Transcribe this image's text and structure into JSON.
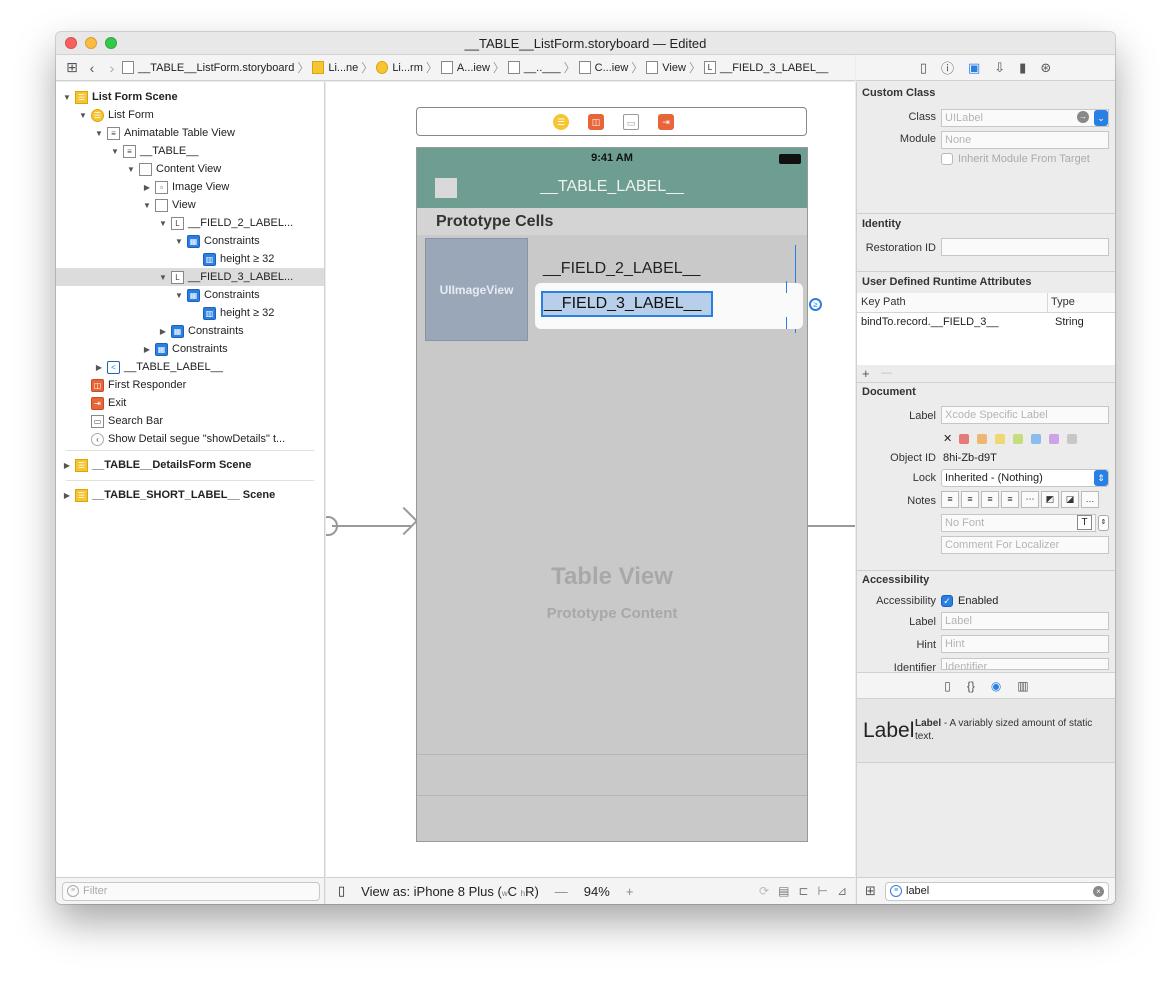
{
  "window": {
    "title": "__TABLE__ListForm.storyboard — Edited",
    "colors": {
      "close": "#fc605c",
      "minimize": "#fdbc40",
      "zoom": "#34c84a",
      "accent": "#2a7fe3"
    }
  },
  "jumpbar": {
    "crumbs": [
      {
        "label": "__TABLE__ListForm.storyboard",
        "icon": "storyboard-file-icon"
      },
      {
        "label": "Li...ne",
        "icon": "scene-icon"
      },
      {
        "label": "Li...rm",
        "icon": "view-controller-icon"
      },
      {
        "label": "A...iew",
        "icon": "table-view-icon"
      },
      {
        "label": "__..___",
        "icon": "table-cell-icon"
      },
      {
        "label": "C...iew",
        "icon": "view-icon"
      },
      {
        "label": "View",
        "icon": "view-icon"
      },
      {
        "label": "__FIELD_3_LABEL__",
        "icon": "label-icon",
        "glyph": "L"
      }
    ]
  },
  "navigator": {
    "rows": [
      {
        "label": "List Form Scene",
        "bold": true,
        "disclosure": "▼",
        "icon": "scene-icon",
        "glyph": "☰"
      },
      {
        "label": "List Form",
        "disclosure": "▼",
        "icon": "view-controller-icon",
        "glyph": "☰"
      },
      {
        "label": "Animatable Table View",
        "disclosure": "▼",
        "icon": "table-view-icon",
        "glyph": "≡"
      },
      {
        "label": "__TABLE__",
        "disclosure": "▼",
        "icon": "table-cell-icon",
        "glyph": "≡"
      },
      {
        "label": "Content View",
        "disclosure": "▼",
        "icon": "view-icon",
        "glyph": ""
      },
      {
        "label": "Image View",
        "disclosure": "▶",
        "icon": "image-view-icon",
        "glyph": "▫"
      },
      {
        "label": "View",
        "disclosure": "▼",
        "icon": "view-icon",
        "glyph": ""
      },
      {
        "label": "__FIELD_2_LABEL...",
        "disclosure": "▼",
        "icon": "label-icon",
        "glyph": "L"
      },
      {
        "label": "Constraints",
        "disclosure": "▼",
        "icon": "constraints-icon",
        "glyph": "▦"
      },
      {
        "label": "height ≥ 32",
        "disclosure": "",
        "icon": "constraint-icon",
        "glyph": "▥"
      },
      {
        "label": "__FIELD_3_LABEL...",
        "disclosure": "▼",
        "icon": "label-icon",
        "glyph": "L",
        "selected": true
      },
      {
        "label": "Constraints",
        "disclosure": "▼",
        "icon": "constraints-icon",
        "glyph": "▦"
      },
      {
        "label": "height ≥ 32",
        "disclosure": "",
        "icon": "constraint-icon",
        "glyph": "▥"
      },
      {
        "label": "Constraints",
        "disclosure": "▶",
        "icon": "constraints-icon",
        "glyph": "▦"
      },
      {
        "label": "Constraints",
        "disclosure": "▶",
        "icon": "constraints-icon",
        "glyph": "▦"
      },
      {
        "label": "__TABLE_LABEL__",
        "disclosure": "▶",
        "icon": "navigation-item-icon",
        "glyph": "<"
      },
      {
        "label": "First Responder",
        "disclosure": "",
        "icon": "first-responder-icon",
        "glyph": "◫"
      },
      {
        "label": "Exit",
        "disclosure": "",
        "icon": "exit-icon",
        "glyph": "⇥"
      },
      {
        "label": "Search Bar",
        "disclosure": "",
        "icon": "search-bar-icon",
        "glyph": "▭"
      },
      {
        "label": "Show Detail segue \"showDetails\" t...",
        "disclosure": "",
        "icon": "segue-icon",
        "glyph": "‹"
      },
      {
        "label": "__TABLE__DetailsForm Scene",
        "bold": true,
        "disclosure": "▶",
        "icon": "scene-icon",
        "glyph": "☰"
      },
      {
        "label": "__TABLE_SHORT_LABEL__ Scene",
        "bold": true,
        "disclosure": "▶",
        "icon": "scene-icon",
        "glyph": "☰"
      }
    ],
    "filter_placeholder": "Filter"
  },
  "canvas": {
    "status_time": "9:41 AM",
    "nav_title": "__TABLE_LABEL__",
    "prototype_header": "Prototype Cells",
    "imageview_label": "UIImageView",
    "field2": "__FIELD_2_LABEL__",
    "field3": "__FIELD_3_LABEL__",
    "placeholder_title": "Table View",
    "placeholder_subtitle": "Prototype Content",
    "statusbar_color": "#6e9e91"
  },
  "canvas_bottom": {
    "view_as": "View as: iPhone 8 Plus (",
    "view_as_w": "w",
    "view_as_c": "C ",
    "view_as_h": "h",
    "view_as_r": "R)",
    "zoom_minus": "—",
    "zoom": "94%",
    "zoom_plus": "+"
  },
  "inspector": {
    "custom_class_title": "Custom Class",
    "class_label": "Class",
    "class_placeholder": "UILabel",
    "module_label": "Module",
    "module_placeholder": "None",
    "inherit_module": "Inherit Module From Target",
    "identity_title": "Identity",
    "restoration_label": "Restoration ID",
    "udra_title": "User Defined Runtime Attributes",
    "col_keypath": "Key Path",
    "col_type": "Type",
    "row_keypath": "bindTo.record.__FIELD_3__",
    "row_type": "String",
    "add_btn": "+",
    "remove_btn": "—",
    "document_title": "Document",
    "doc_label_label": "Label",
    "doc_label_placeholder": "Xcode Specific Label",
    "swatches": [
      "#e05555",
      "#f0a34a",
      "#f0d24a",
      "#b8d858",
      "#6aaef0",
      "#c58ae6",
      "#bbbbbb"
    ],
    "swatch_clear": "✕",
    "object_id_label": "Object ID",
    "object_id": "8hi-Zb-d9T",
    "lock_label": "Lock",
    "lock_value": "Inherited - (Nothing)",
    "notes_label": "Notes",
    "font_placeholder": "No Font",
    "localizer_placeholder": "Comment For Localizer",
    "accessibility_title": "Accessibility",
    "acc_label": "Accessibility",
    "acc_enabled": "Enabled",
    "acc_label_label": "Label",
    "acc_label_placeholder": "Label",
    "hint_label": "Hint",
    "hint_placeholder": "Hint",
    "identifier_label": "Identifier",
    "identifier_placeholder": "Identifier"
  },
  "library": {
    "item_big": "Label",
    "item_name": "Label",
    "item_desc": " - A variably sized amount of static text.",
    "search_value": "label"
  }
}
